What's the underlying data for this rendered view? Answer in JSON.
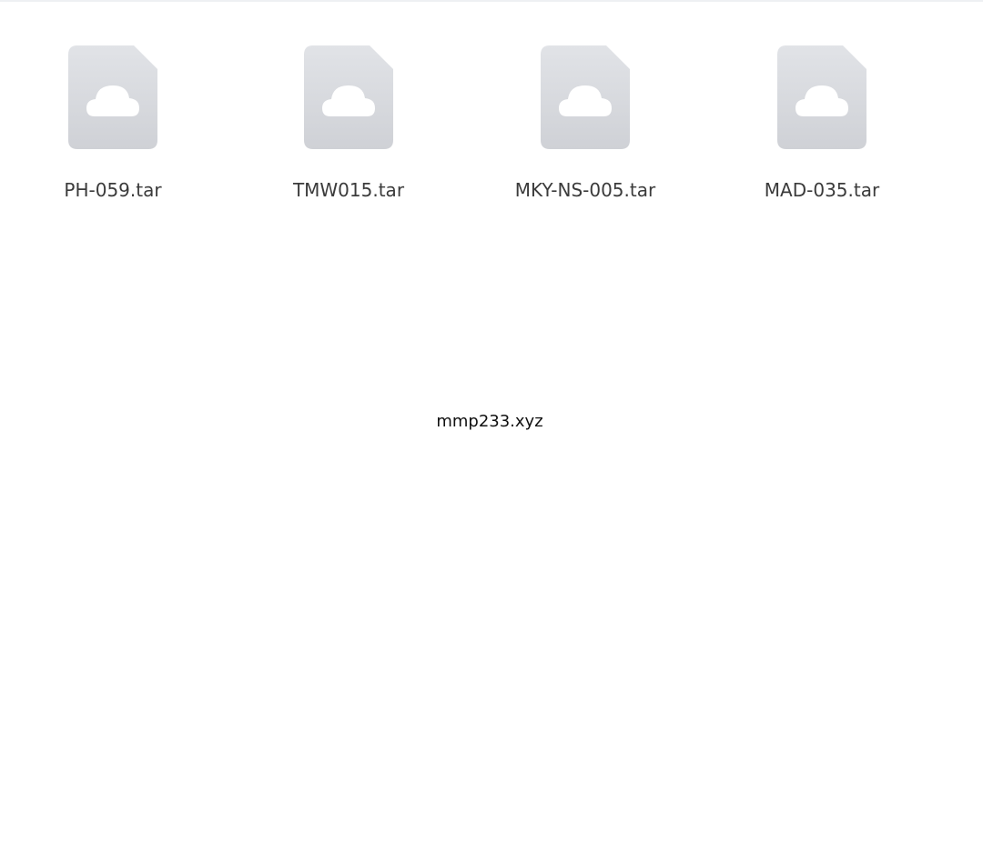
{
  "files": [
    {
      "name": "PH-059.tar",
      "icon": "cloud-file-icon"
    },
    {
      "name": "TMW015.tar",
      "icon": "cloud-file-icon"
    },
    {
      "name": "MKY-NS-005.tar",
      "icon": "cloud-file-icon"
    },
    {
      "name": "MAD-035.tar",
      "icon": "cloud-file-icon"
    }
  ],
  "watermark": "mmp233.xyz",
  "colors": {
    "background": "#ffffff",
    "icon_top": "#e1e3e7",
    "icon_bottom": "#cfd1d6",
    "cloud": "#ffffff",
    "label": "#3b3b3b"
  }
}
